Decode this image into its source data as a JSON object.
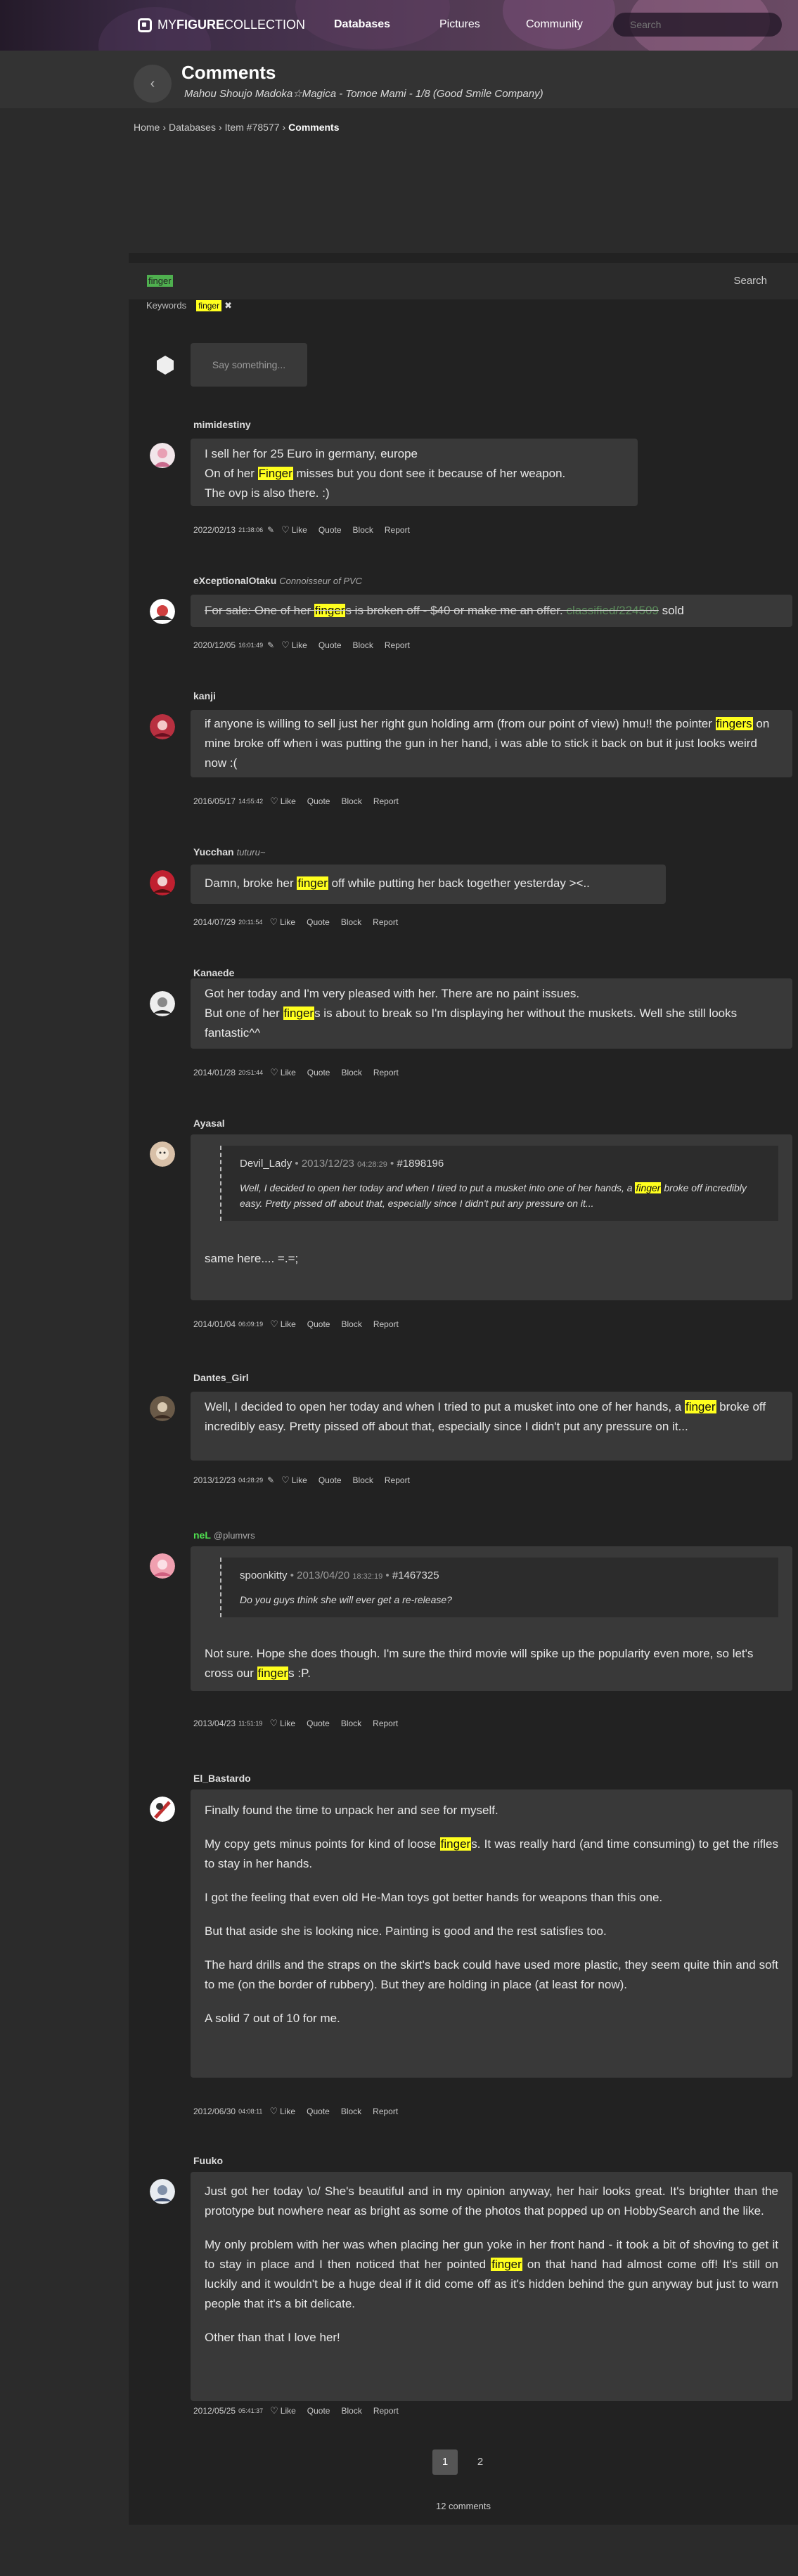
{
  "topbar": {
    "brand_my": "MY",
    "brand_figure": "FIGURE",
    "brand_collection": "COLLECTION",
    "nav": [
      "Databases",
      "Pictures",
      "Community"
    ],
    "search_placeholder": "Search"
  },
  "header": {
    "back_icon": "‹",
    "title": "Comments",
    "subtitle": "Mahou Shoujo Madoka☆Magica - Tomoe Mami - 1/8 (Good Smile Company)"
  },
  "breadcrumb": {
    "items": [
      "Home",
      "Databases",
      "Item #78577",
      "Comments"
    ],
    "sep": "›"
  },
  "search": {
    "query": "finger",
    "button": "Search",
    "keywords_label": "Keywords",
    "keyword": "finger",
    "remove_icon": "✖"
  },
  "composer": {
    "placeholder": "Say something..."
  },
  "actions": {
    "like": "Like",
    "quote": "Quote",
    "block": "Block",
    "report": "Report"
  },
  "comments": [
    {
      "user": "mimidestiny",
      "date": "2022/02/13",
      "time": "21:38:06",
      "lines": [
        "I sell her for 25 Euro in germany, europe",
        "On of her ",
        "Finger",
        " misses but you dont see it because of her weapon.",
        "The ovp is also there. :)"
      ]
    },
    {
      "user": "eXceptionalOtaku",
      "tag": "Connoisseur of PVC",
      "date": "2020/12/05",
      "time": "16:01:49",
      "text_a": "For sale: One of her ",
      "hl": "finger",
      "text_b": "s is broken off - $40 or make me an offer. ",
      "link": "classified/224509",
      "text_c": " sold"
    },
    {
      "user": "kanji",
      "date": "2016/05/17",
      "time": "14:55:42",
      "text_a": "if anyone is willing to sell just her right gun holding arm (from our point of view) hmu!! the pointer ",
      "hl": "fingers",
      "text_b": " on mine broke off when i was putting the gun in her hand, i was able to stick it back on but it just looks weird now :("
    },
    {
      "user": "Yucchan",
      "tag": "tuturu~",
      "date": "2014/07/29",
      "time": "20:11:54",
      "text_a": "Damn, broke her ",
      "hl": "finger",
      "text_b": " off while putting her back together yesterday ><.."
    },
    {
      "user": "Kanaede",
      "date": "2014/01/28",
      "time": "20:51:44",
      "text_0": "Got her today and I'm very pleased with her. There are no paint issues.",
      "text_a": "But one of her ",
      "hl": "finger",
      "text_b": "s is about to break so I'm displaying her without the muskets. Well she still looks fantastic^^"
    },
    {
      "user": "Ayasal",
      "date": "2014/01/04",
      "time": "06:09:19",
      "quote_user": "Devil_Lady",
      "quote_date": "2013/12/23",
      "quote_time": "04:28:29",
      "quote_id": "#1898196",
      "quote_a": "Well, I decided to open her today and when I tired to put a musket into one of her hands, a ",
      "quote_hl": "finger",
      "quote_b": " broke off incredibly easy. Pretty pissed off about that, especially since I didn't put any pressure on it...",
      "text": "same here.... =.=;"
    },
    {
      "user": "Dantes_Girl",
      "date": "2013/12/23",
      "time": "04:28:29",
      "text_a": "Well, I decided to open her today and when I tried to put a musket into one of her hands, a ",
      "hl": "finger",
      "text_b": " broke off incredibly easy. Pretty pissed off about that, especially since I didn't put any pressure on it..."
    },
    {
      "user": "neL",
      "handle": "@plumvrs",
      "date": "2013/04/23",
      "time": "11:51:19",
      "quote_user": "spoonkitty",
      "quote_date": "2013/04/20",
      "quote_time": "18:32:19",
      "quote_id": "#1467325",
      "quote_text": "Do you guys think she will ever get a re-release?",
      "text_a": "Not sure. Hope she does though. I'm sure the third movie will spike up the popularity even more, so let's cross our ",
      "hl": "finger",
      "text_b": "s :P."
    },
    {
      "user": "El_Bastardo",
      "date": "2012/06/30",
      "time": "04:08:11",
      "p1": "Finally found the time to unpack her and see for myself.",
      "p2a": "My copy gets minus points for kind of loose ",
      "p2hl": "finger",
      "p2b": "s. It was really hard (and time consuming) to get the rifles to stay in her hands.",
      "p3": "I got the feeling that even old He-Man toys got better hands for weapons than this one.",
      "p4": "But that aside she is looking nice. Painting is good and the rest satisfies too.",
      "p5": "The hard drills and the straps on the skirt's back could have used more plastic, they seem quite thin and soft to me (on the border of rubbery). But they are holding in place (at least for now).",
      "p6": "A solid 7 out of 10 for me."
    },
    {
      "user": "Fuuko",
      "date": "2012/05/25",
      "time": "05:41:37",
      "p1": "Just got her today \\o/ She's beautiful and in my opinion anyway, her hair looks great. It's brighter than the prototype but nowhere near as bright as some of the photos that popped up on HobbySearch and the like.",
      "p2a": "My only problem with her was when placing her gun yoke in her front hand - it took a bit of shoving to get it to stay in place and I then noticed that her pointed ",
      "p2hl": "finger",
      "p2b": " on that hand had almost come off! It's still on luckily and it wouldn't be a huge deal if it did come off as it's hidden behind the gun anyway but just to warn people that it's a bit delicate.",
      "p3": "Other than that I love her!"
    }
  ],
  "pagination": {
    "pages": [
      "1",
      "2"
    ],
    "current": "1"
  },
  "footer": {
    "count": "12 comments"
  },
  "colors": {
    "highlight": "#ffff1e",
    "panel": "#222222",
    "bubble": "#393939",
    "green_user": "#4fe04f"
  }
}
